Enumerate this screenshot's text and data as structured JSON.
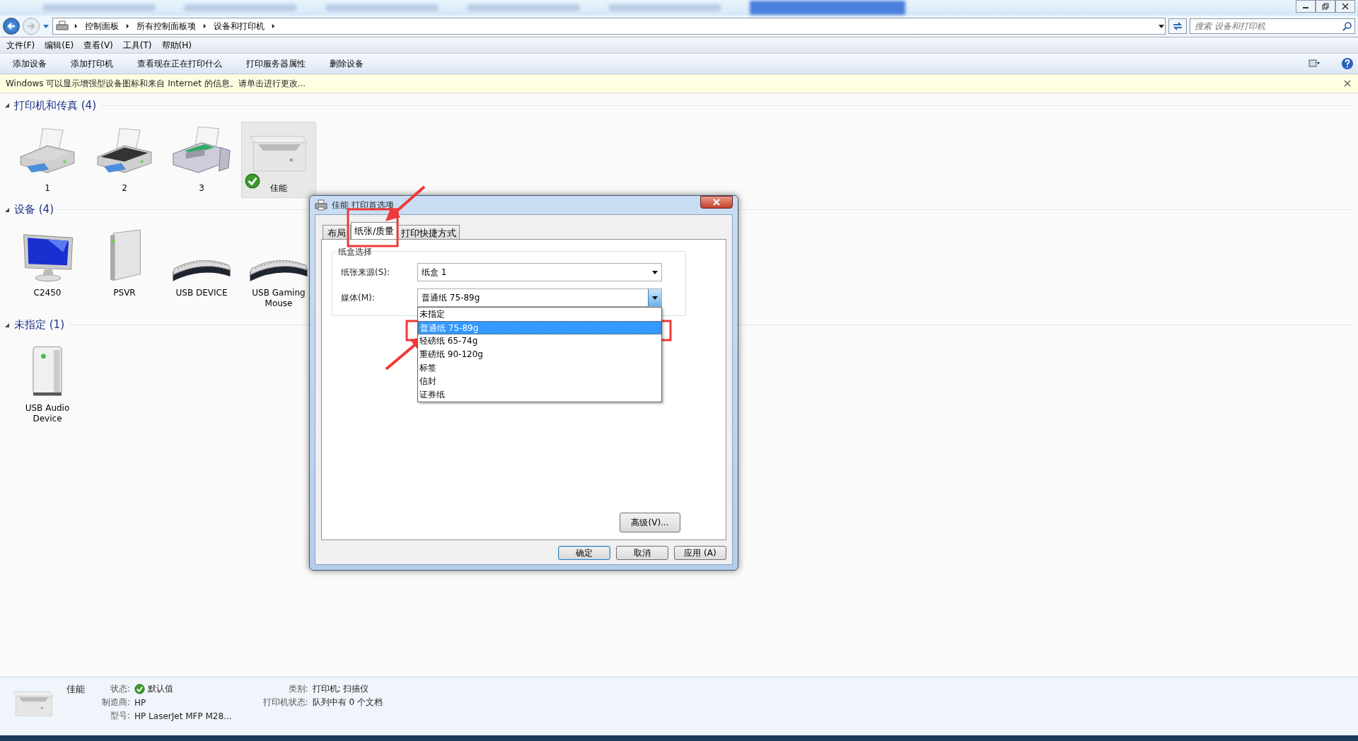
{
  "browser_tabs": [
    {
      "selected": false
    },
    {
      "selected": false
    },
    {
      "selected": false
    },
    {
      "selected": false
    },
    {
      "selected": false
    },
    {
      "selected": true
    }
  ],
  "address_bar": {
    "crumbs": [
      "控制面板",
      "所有控制面板项",
      "设备和打印机"
    ],
    "search": {
      "placeholder": "搜索 设备和打印机"
    }
  },
  "menu": [
    "文件(F)",
    "编辑(E)",
    "查看(V)",
    "工具(T)",
    "帮助(H)"
  ],
  "toolbar": [
    "添加设备",
    "添加打印机",
    "查看现在正在打印什么",
    "打印服务器属性",
    "删除设备"
  ],
  "info_bar": {
    "text": "Windows 可以显示增强型设备图标和来自 Internet 的信息。请单击进行更改..."
  },
  "groups": [
    {
      "title": "打印机和传真 (4)",
      "expanded": true,
      "items": [
        {
          "label": "1",
          "kind": "printer",
          "selected": false,
          "default": false
        },
        {
          "label": "2",
          "kind": "printer-dark",
          "selected": false,
          "default": false
        },
        {
          "label": "3",
          "kind": "fax",
          "selected": false,
          "default": false
        },
        {
          "label": "佳能",
          "kind": "mfp",
          "selected": true,
          "default": true
        }
      ]
    },
    {
      "title": "设备 (4)",
      "expanded": true,
      "items": [
        {
          "label": "C2450",
          "kind": "monitor",
          "selected": false,
          "default": false
        },
        {
          "label": "PSVR",
          "kind": "drive",
          "selected": false,
          "default": false
        },
        {
          "label": "USB DEVICE",
          "kind": "keyboard",
          "selected": false,
          "default": false
        },
        {
          "label": "USB Gaming Mouse",
          "kind": "keyboard",
          "selected": false,
          "default": false
        }
      ]
    },
    {
      "title": "未指定 (1)",
      "expanded": true,
      "items": [
        {
          "label": "USB Audio Device",
          "kind": "box",
          "selected": false,
          "default": false
        }
      ]
    }
  ],
  "dialog": {
    "title": "佳能 打印首选项",
    "tabs": [
      {
        "label": "布局",
        "selected": false
      },
      {
        "label": "纸张/质量",
        "selected": true
      },
      {
        "label": "打印快捷方式",
        "selected": false
      }
    ],
    "group_title": "纸盒选择",
    "fields": [
      {
        "label": "纸张来源(S):",
        "value": "纸盒 1",
        "open": false
      },
      {
        "label": "媒体(M):",
        "value": "普通纸 75-89g",
        "open": true,
        "options": [
          {
            "label": "未指定",
            "selected": false
          },
          {
            "label": "普通纸 75-89g",
            "selected": true
          },
          {
            "label": "轻磅纸 65-74g",
            "selected": false
          },
          {
            "label": "重磅纸 90-120g",
            "selected": false
          },
          {
            "label": "标签",
            "selected": false
          },
          {
            "label": "信封",
            "selected": false
          },
          {
            "label": "证券纸",
            "selected": false
          }
        ]
      }
    ],
    "advanced": "高级(V)...",
    "buttons": [
      "确定",
      "取消",
      "应用 (A)"
    ]
  },
  "details": {
    "name": "佳能",
    "columns": [
      [
        {
          "label": "状态:",
          "value": "默认值",
          "kind": "status"
        },
        {
          "label": "制造商:",
          "value": "HP",
          "kind": "text"
        },
        {
          "label": "型号:",
          "value": "HP LaserJet MFP M28...",
          "kind": "text"
        }
      ],
      [
        {
          "label": "类别:",
          "value": "打印机; 扫描仪",
          "kind": "text"
        },
        {
          "label": "打印机状态:",
          "value": "队列中有 0 个文档",
          "kind": "text"
        }
      ]
    ]
  }
}
